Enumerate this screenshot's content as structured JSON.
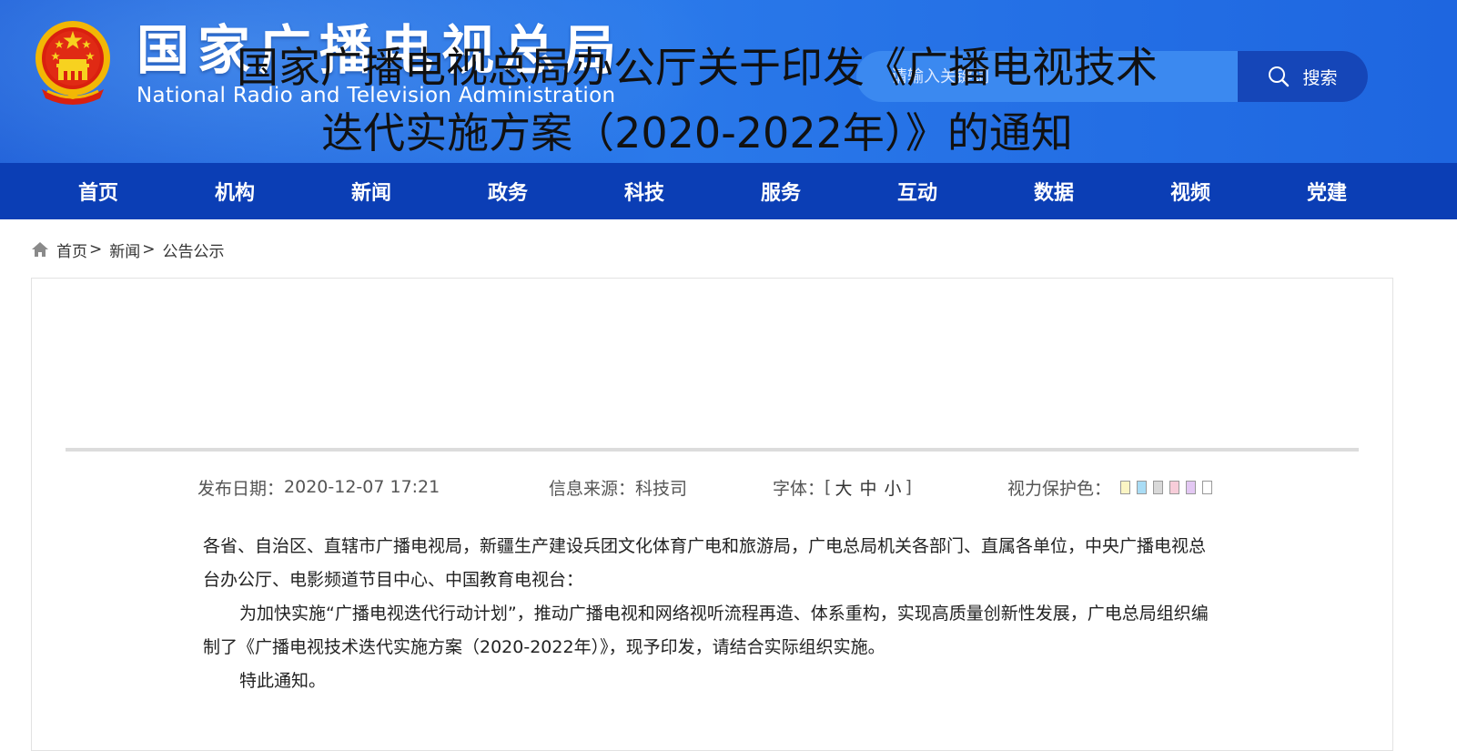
{
  "header": {
    "title": "国家广播电视总局",
    "subtitle": "National Radio and Television Administration",
    "search_placeholder": "请输入关键词",
    "search_button": "搜索"
  },
  "nav": {
    "items": [
      "首页",
      "机构",
      "新闻",
      "政务",
      "科技",
      "服务",
      "互动",
      "数据",
      "视频",
      "党建"
    ]
  },
  "breadcrumb": {
    "items": [
      "首页",
      "新闻",
      "公告公示"
    ],
    "separator": ">"
  },
  "article": {
    "title_line1": "国家广播电视总局办公厅关于印发《广播电视技术",
    "title_line2": "迭代实施方案（2020-2022年）》的通知",
    "publish_label": "发布日期：",
    "publish_date": "2020-12-07 17:21",
    "source_label": "信息来源：",
    "source": "科技司",
    "font_label": "字体：",
    "font_open": "[",
    "font_large": "大",
    "font_medium": "中",
    "font_small": "小",
    "font_close": "]",
    "eye_label": "视力保护色：",
    "eye_colors": [
      "#fbf5c4",
      "#a9dcf5",
      "#d9d9d9",
      "#f7cdd9",
      "#e3c8f3",
      "#ffffff"
    ],
    "paragraph1": "各省、自治区、直辖市广播电视局，新疆生产建设兵团文化体育广电和旅游局，广电总局机关各部门、直属各单位，中央广播电视总台办公厅、电影频道节目中心、中国教育电视台：",
    "paragraph2": "为加快实施“广播电视迭代行动计划”，推动广播电视和网络视听流程再造、体系重构，实现高质量创新性发展，广电总局组织编制了《广播电视技术迭代实施方案（2020-2022年）》，现予印发，请结合实际组织实施。",
    "paragraph3": "特此通知。"
  },
  "colors": {
    "header_blue": "#2a79ea",
    "nav_blue": "#0b3eb5",
    "search_button_blue": "#1546b8"
  },
  "icons": [
    "national-emblem-icon",
    "search-icon",
    "home-icon"
  ]
}
